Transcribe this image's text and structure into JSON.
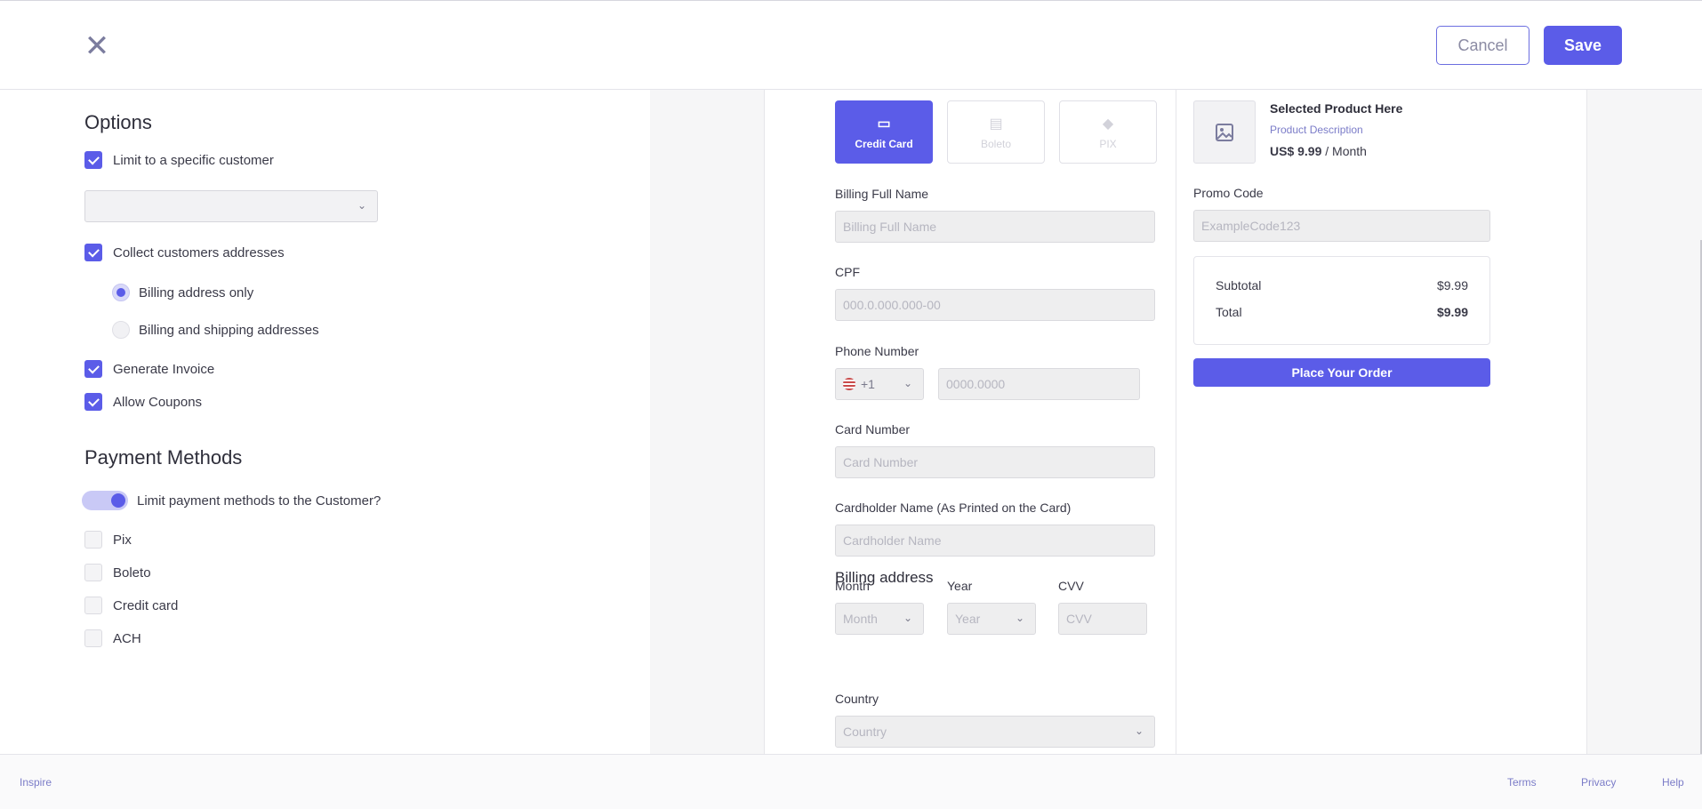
{
  "header": {
    "close_icon": "close-icon",
    "cancel_label": "Cancel",
    "save_label": "Save"
  },
  "options": {
    "title": "Options",
    "limit_customer": {
      "label": "Limit to a specific customer",
      "checked": true
    },
    "customer_select": {
      "value": ""
    },
    "collect_addresses": {
      "label": "Collect customers addresses",
      "checked": true
    },
    "billing_only": {
      "label": "Billing address only",
      "selected": true
    },
    "billing_shipping": {
      "label": "Billing and shipping addresses",
      "selected": false
    },
    "generate_invoice": {
      "label": "Generate Invoice",
      "checked": true
    },
    "allow_coupons": {
      "label": "Allow Coupons",
      "checked": true
    }
  },
  "payment_methods": {
    "title": "Payment Methods",
    "limit_toggle": {
      "label": "Limit payment methods to the Customer?",
      "on": true
    },
    "items": [
      {
        "label": "Pix",
        "checked": false
      },
      {
        "label": "Boleto",
        "checked": false
      },
      {
        "label": "Credit card",
        "checked": false
      },
      {
        "label": "ACH",
        "checked": false
      }
    ]
  },
  "checkout": {
    "methods": [
      {
        "label": "Credit Card",
        "icon": "credit-card-icon",
        "active": true
      },
      {
        "label": "Boleto",
        "icon": "barcode-icon",
        "active": false
      },
      {
        "label": "PIX",
        "icon": "pix-icon",
        "active": false
      }
    ],
    "billing_name": {
      "label": "Billing Full Name",
      "placeholder": "Billing Full Name"
    },
    "cpf": {
      "label": "CPF",
      "placeholder": "000.0.000.000-00"
    },
    "phone": {
      "label": "Phone Number",
      "country_code": "+1",
      "placeholder": "0000.0000"
    },
    "card_number": {
      "label": "Card Number",
      "placeholder": "Card Number"
    },
    "cardholder": {
      "label": "Cardholder Name (As Printed on the Card)",
      "placeholder": "Cardholder Name"
    },
    "month": {
      "label": "Month",
      "placeholder": "Month"
    },
    "year": {
      "label": "Year",
      "placeholder": "Year"
    },
    "cvv": {
      "label": "CVV",
      "placeholder": "CVV"
    },
    "billing_address_title": "Billing address",
    "country": {
      "label": "Country",
      "placeholder": "Country"
    }
  },
  "summary": {
    "product_name": "Selected Product Here",
    "product_description": "Product Description",
    "price": "US$ 9.99",
    "period": "/ Month",
    "promo_label": "Promo Code",
    "promo_placeholder": "ExampleCode123",
    "subtotal_label": "Subtotal",
    "subtotal_value": "$9.99",
    "total_label": "Total",
    "total_value": "$9.99",
    "order_button": "Place Your Order"
  },
  "footer": {
    "brand": "Inspire",
    "terms": "Terms",
    "privacy": "Privacy",
    "help": "Help"
  },
  "colors": {
    "accent": "#5b5ce8",
    "link": "#7b7cc8"
  }
}
